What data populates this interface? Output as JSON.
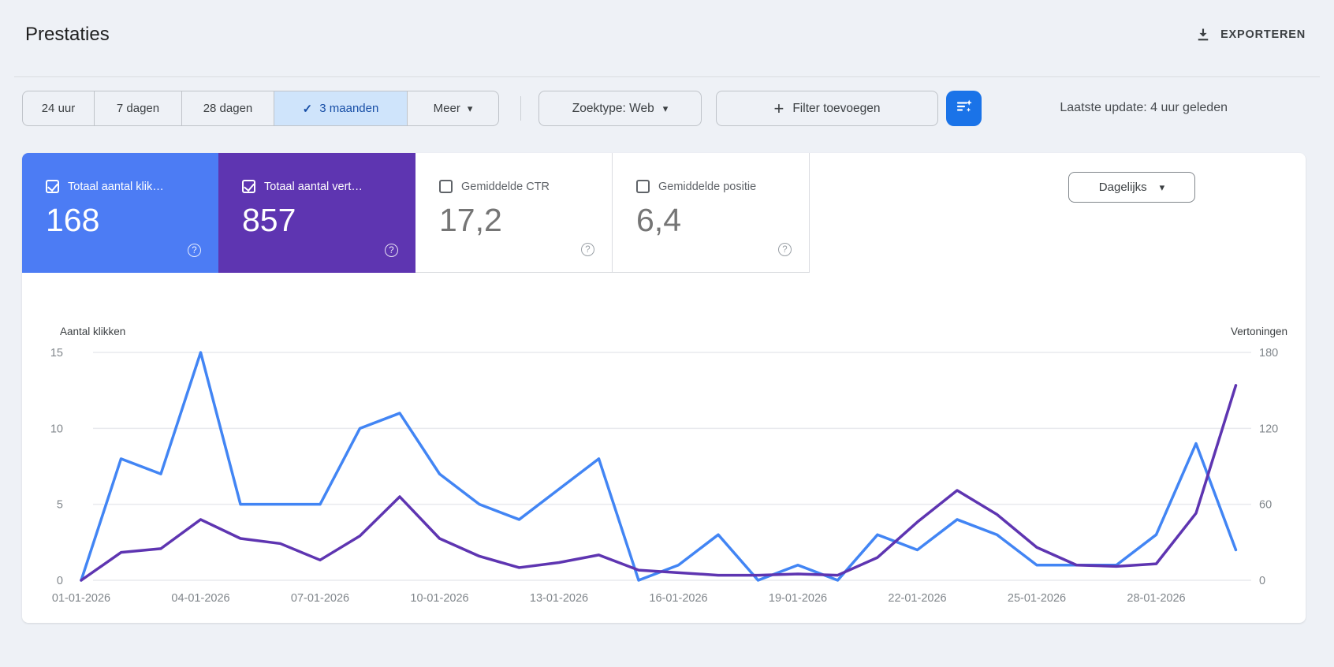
{
  "header": {
    "title": "Prestaties",
    "export_label": "EXPORTEREN"
  },
  "filters": {
    "date_ranges": [
      "24 uur",
      "7 dagen",
      "28 dagen",
      "3 maanden",
      "Meer"
    ],
    "selected_range": "3 maanden",
    "search_type": "Zoektype: Web",
    "add_filter": "Filter toevoegen",
    "last_update": "Laatste update: 4 uur geleden"
  },
  "metrics": {
    "granularity": "Dagelijks",
    "cards": [
      {
        "label": "Totaal aantal klik…",
        "value": "168",
        "checked": true,
        "color": "#4c7cf4"
      },
      {
        "label": "Totaal aantal vert…",
        "value": "857",
        "checked": true,
        "color": "#5e35b1"
      },
      {
        "label": "Gemiddelde CTR",
        "value": "17,2",
        "checked": false,
        "color": "#ffffff"
      },
      {
        "label": "Gemiddelde positie",
        "value": "6,4",
        "checked": false,
        "color": "#ffffff"
      }
    ]
  },
  "chart_data": {
    "type": "line",
    "title": "",
    "grid": "horizontal",
    "x": [
      "01-01-2026",
      "02-01-2026",
      "03-01-2026",
      "04-01-2026",
      "05-01-2026",
      "06-01-2026",
      "07-01-2026",
      "08-01-2026",
      "09-01-2026",
      "10-01-2026",
      "11-01-2026",
      "12-01-2026",
      "13-01-2026",
      "14-01-2026",
      "15-01-2026",
      "16-01-2026",
      "17-01-2026",
      "18-01-2026",
      "19-01-2026",
      "20-01-2026",
      "21-01-2026",
      "22-01-2026",
      "23-01-2026",
      "24-01-2026",
      "25-01-2026",
      "26-01-2026",
      "27-01-2026",
      "28-01-2026",
      "29-01-2026",
      "30-01-2026"
    ],
    "x_tick_every": 3,
    "left_axis": {
      "label": "Aantal klikken",
      "ticks": [
        0,
        5,
        10,
        15
      ],
      "max": 15
    },
    "right_axis": {
      "label": "Vertoningen",
      "ticks": [
        0,
        60,
        120,
        180
      ],
      "max": 180
    },
    "series": [
      {
        "name": "Aantal klikken",
        "axis": "left",
        "color": "#4285f4",
        "values": [
          0,
          8,
          7,
          15,
          5,
          5,
          5,
          10,
          11,
          7,
          5,
          4,
          6,
          8,
          0,
          1,
          3,
          0,
          1,
          0,
          3,
          2,
          4,
          3,
          1,
          1,
          1,
          3,
          9,
          2
        ]
      },
      {
        "name": "Vertoningen",
        "axis": "right",
        "color": "#5e35b1",
        "values": [
          0,
          22,
          25,
          48,
          33,
          29,
          16,
          35,
          66,
          33,
          19,
          10,
          14,
          20,
          8,
          6,
          4,
          4,
          5,
          4,
          18,
          46,
          71,
          52,
          26,
          12,
          11,
          13,
          53,
          154
        ]
      }
    ]
  }
}
